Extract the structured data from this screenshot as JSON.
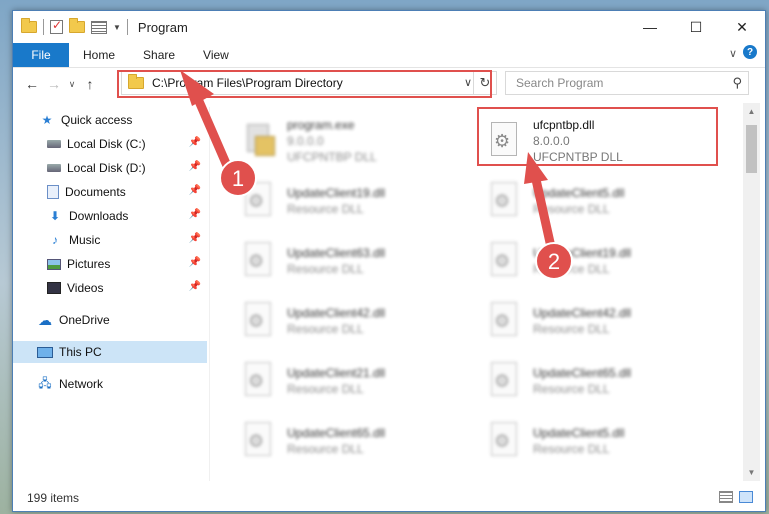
{
  "window": {
    "title": "Program"
  },
  "ribbon": {
    "file": "File",
    "tabs": [
      "Home",
      "Share",
      "View"
    ],
    "help": "?"
  },
  "address": {
    "path": "C:\\Program Files\\Program Directory"
  },
  "search": {
    "placeholder": "Search Program"
  },
  "sidebar": {
    "items": [
      {
        "label": "Quick access",
        "icon": "star-icon"
      },
      {
        "label": "Local Disk (C:)",
        "icon": "drive-icon",
        "pinned": true
      },
      {
        "label": "Local Disk (D:)",
        "icon": "drive-icon",
        "pinned": true
      },
      {
        "label": "Documents",
        "icon": "document-icon",
        "pinned": true
      },
      {
        "label": "Downloads",
        "icon": "download-icon",
        "pinned": true
      },
      {
        "label": "Music",
        "icon": "music-icon",
        "pinned": true
      },
      {
        "label": "Pictures",
        "icon": "pictures-icon",
        "pinned": true
      },
      {
        "label": "Videos",
        "icon": "videos-icon",
        "pinned": true
      },
      {
        "label": "OneDrive",
        "icon": "cloud-icon"
      },
      {
        "label": "This PC",
        "icon": "computer-icon",
        "selected": true
      },
      {
        "label": "Network",
        "icon": "network-icon"
      }
    ]
  },
  "files": {
    "left": [
      {
        "name": "program.exe",
        "sub1": "9.0.0.0",
        "sub2": "UFCPNTBP DLL"
      },
      {
        "name": "UpdateClient19.dll",
        "sub1": "Resource DLL"
      },
      {
        "name": "UpdateClient63.dll",
        "sub1": "Resource DLL"
      },
      {
        "name": "UpdateClient42.dll",
        "sub1": "Resource DLL"
      },
      {
        "name": "UpdateClient21.dll",
        "sub1": "Resource DLL"
      },
      {
        "name": "UpdateClient65.dll",
        "sub1": "Resource DLL"
      }
    ],
    "right": [
      {
        "name": "ufcpntbp.dll",
        "sub1": "8.0.0.0",
        "sub2": "UFCPNTBP DLL"
      },
      {
        "name": "UpdateClient5.dll",
        "sub1": "Resource DLL"
      },
      {
        "name": "UpdateClient19.dll",
        "sub1": "Resource DLL"
      },
      {
        "name": "UpdateClient42.dll",
        "sub1": "Resource DLL"
      },
      {
        "name": "UpdateClient65.dll",
        "sub1": "Resource DLL"
      },
      {
        "name": "UpdateClient5.dll",
        "sub1": "Resource DLL"
      }
    ]
  },
  "status": {
    "item_count": "199 items"
  },
  "annotations": {
    "badge1": "1",
    "badge2": "2"
  },
  "colors": {
    "accent": "#1979ca",
    "highlight": "#e0504d",
    "selection": "#cce4f7"
  }
}
